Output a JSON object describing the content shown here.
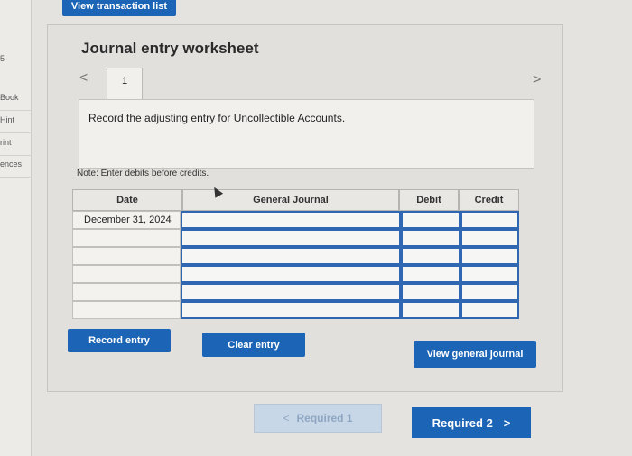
{
  "sidebar": {
    "items": [
      {
        "label": "5"
      },
      {
        "label": "Book"
      },
      {
        "label": "Hint"
      },
      {
        "label": "rint"
      },
      {
        "label": "ences"
      }
    ]
  },
  "top": {
    "view_transaction_list": "View transaction list"
  },
  "worksheet": {
    "title": "Journal entry worksheet",
    "prev_icon": "<",
    "next_icon": ">",
    "tab_number": "1",
    "instruction": "Record the adjusting entry for Uncollectible Accounts.",
    "note": "Note: Enter debits before credits."
  },
  "table": {
    "headers": {
      "date": "Date",
      "journal": "General Journal",
      "debit": "Debit",
      "credit": "Credit"
    },
    "rows": [
      {
        "date": "December 31, 2024"
      },
      {
        "date": ""
      },
      {
        "date": ""
      },
      {
        "date": ""
      },
      {
        "date": ""
      },
      {
        "date": ""
      }
    ]
  },
  "buttons": {
    "record": "Record entry",
    "clear": "Clear entry",
    "view_general": "View general journal"
  },
  "pager": {
    "prev": "Required 1",
    "prev_icon": "<",
    "next": "Required 2",
    "next_icon": ">"
  }
}
